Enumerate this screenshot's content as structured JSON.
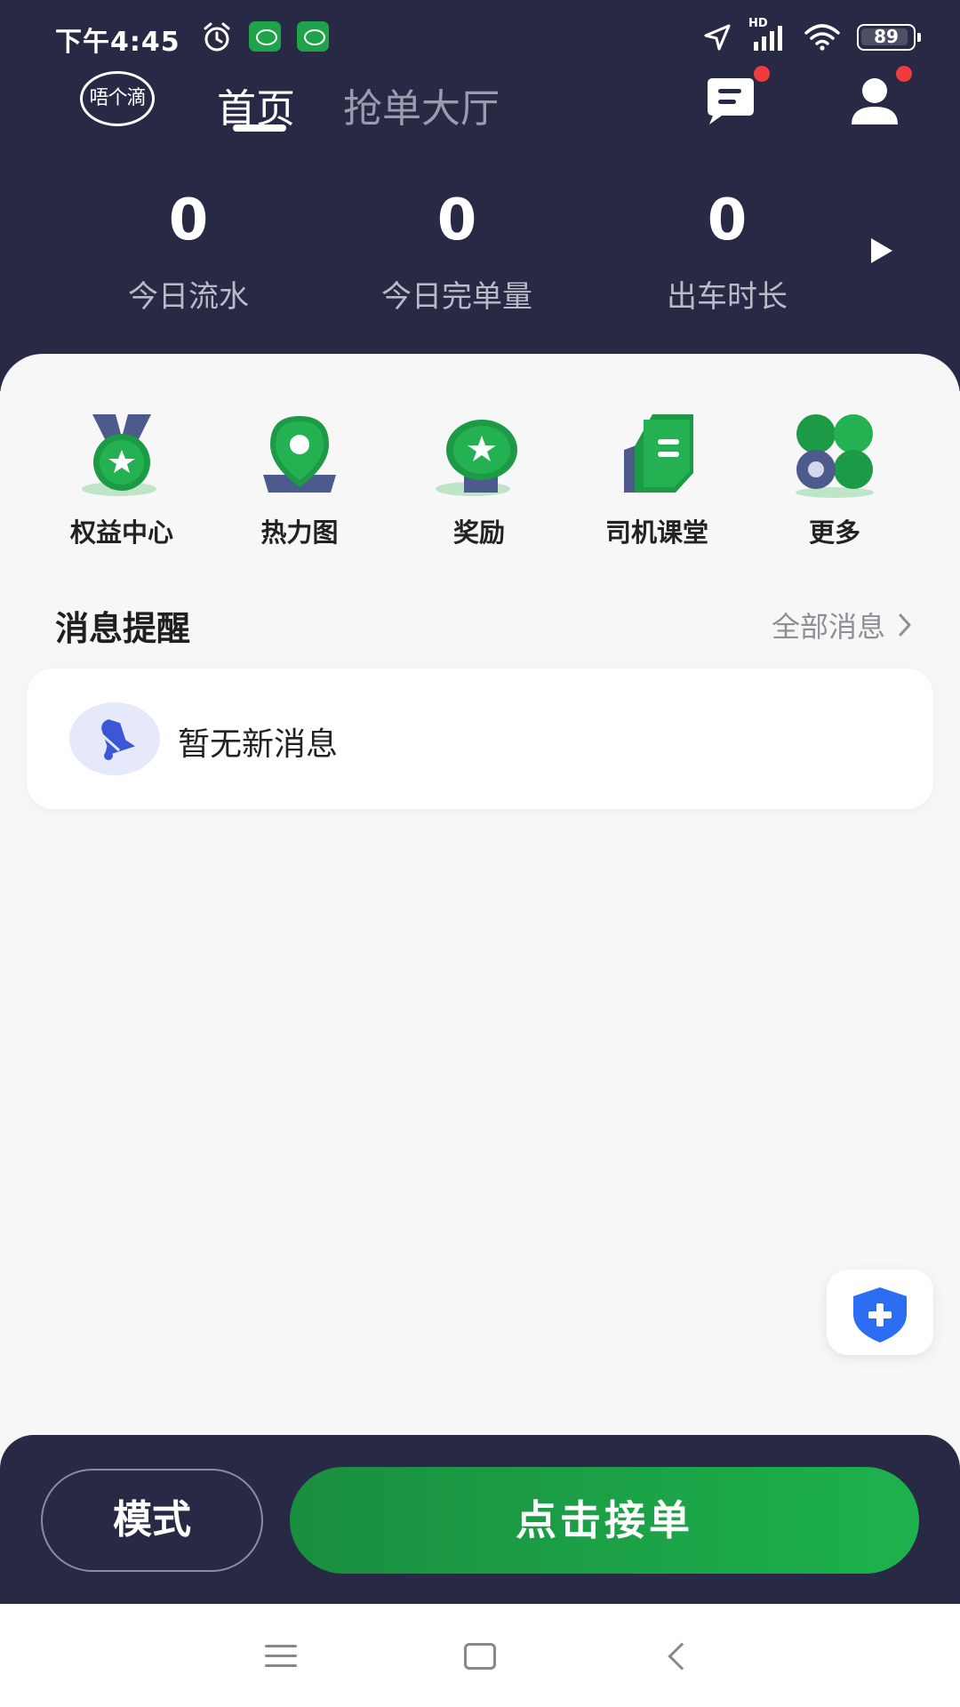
{
  "status_bar": {
    "time": "下午4:45",
    "network_badge": "HD",
    "battery": "89"
  },
  "header": {
    "logo_text": "唔个滴",
    "tabs": [
      {
        "label": "首页",
        "active": true
      },
      {
        "label": "抢单大厅",
        "active": false
      }
    ],
    "message_badge": true,
    "profile_badge": true
  },
  "stats": [
    {
      "value": "0",
      "label": "今日流水"
    },
    {
      "value": "0",
      "label": "今日完单量"
    },
    {
      "value": "0",
      "label": "出车时长"
    }
  ],
  "features": [
    {
      "label": "权益中心",
      "icon": "medal-star-icon"
    },
    {
      "label": "热力图",
      "icon": "map-pin-icon"
    },
    {
      "label": "奖励",
      "icon": "award-star-icon"
    },
    {
      "label": "司机课堂",
      "icon": "book-icon"
    },
    {
      "label": "更多",
      "icon": "more-grid-icon"
    }
  ],
  "messages": {
    "title": "消息提醒",
    "all_link": "全部消息",
    "empty_text": "暂无新消息"
  },
  "actions": {
    "mode_label": "模式",
    "accept_label": "点击接单"
  },
  "colors": {
    "header_bg": "#282a45",
    "accent_green": "#1db24d",
    "badge_red": "#f23a3a",
    "shield_blue": "#2b6ef2"
  }
}
